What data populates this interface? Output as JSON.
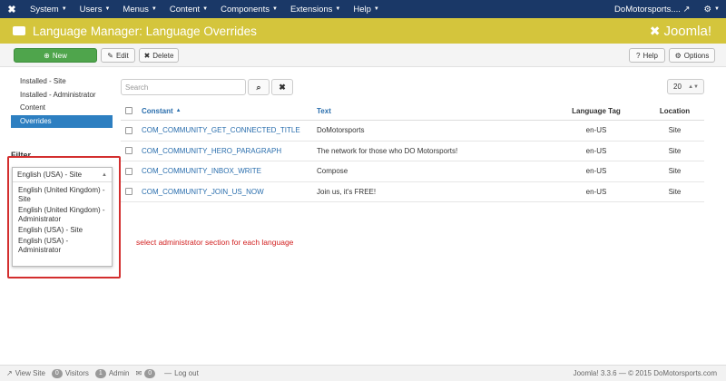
{
  "topnav": {
    "menus": [
      "System",
      "Users",
      "Menus",
      "Content",
      "Components",
      "Extensions",
      "Help"
    ],
    "site_name": "DoMotorsports...."
  },
  "header": {
    "title": "Language Manager: Language Overrides",
    "brand": "Joomla!"
  },
  "toolbar": {
    "new_label": "New",
    "edit_label": "Edit",
    "delete_label": "Delete",
    "help_label": "Help",
    "options_label": "Options"
  },
  "sidebar": {
    "items": [
      "Installed - Site",
      "Installed - Administrator",
      "Content",
      "Overrides"
    ],
    "active": "Overrides"
  },
  "filter": {
    "label": "Filter",
    "selected": "English (USA) - Site",
    "options": [
      "English (United Kingdom) - Site",
      "English (United Kingdom) - Administrator",
      "English (USA) - Site",
      "English (USA) - Administrator"
    ]
  },
  "search": {
    "placeholder": "Search",
    "limit": "20"
  },
  "table": {
    "headers": {
      "constant": "Constant",
      "text": "Text",
      "language_tag": "Language Tag",
      "location": "Location"
    },
    "rows": [
      {
        "constant": "COM_COMMUNITY_GET_CONNECTED_TITLE",
        "text": "DoMotorsports",
        "tag": "en-US",
        "location": "Site"
      },
      {
        "constant": "COM_COMMUNITY_HERO_PARAGRAPH",
        "text": "The network for those who DO Motorsports!",
        "tag": "en-US",
        "location": "Site"
      },
      {
        "constant": "COM_COMMUNITY_INBOX_WRITE",
        "text": "Compose",
        "tag": "en-US",
        "location": "Site"
      },
      {
        "constant": "COM_COMMUNITY_JOIN_US_NOW",
        "text": "Join us, it's FREE!",
        "tag": "en-US",
        "location": "Site"
      }
    ]
  },
  "annotation": "select administrator section for each language",
  "footer": {
    "view_site": "View Site",
    "visitors_count": "0",
    "visitors": "Visitors",
    "admin_count": "1",
    "admin": "Admin",
    "messages_count": "0",
    "logout": "Log out",
    "copyright": "Joomla! 3.3.6 — © 2015 DoMotorsports.com"
  },
  "colors": {
    "nav": "#1a3867",
    "header": "#d4c53c",
    "new_button": "#4fa54c",
    "active_item": "#2d7fc1",
    "link": "#2a6ead",
    "annotation": "#d11f1f"
  }
}
